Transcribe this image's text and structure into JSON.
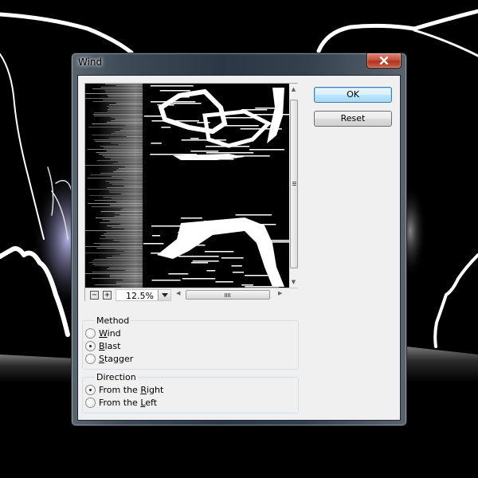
{
  "window": {
    "title": "Wind",
    "close_icon": "close-icon"
  },
  "preview": {
    "zoom_out_label": "−",
    "zoom_in_label": "+",
    "zoom_level": "12.5%",
    "icons": {
      "zoom_out": "minus-icon",
      "zoom_in": "plus-icon",
      "dropdown": "chevron-down-icon",
      "scroll_up": "arrow-up-icon",
      "scroll_down": "arrow-down-icon",
      "scroll_left": "arrow-left-icon",
      "scroll_right": "arrow-right-icon"
    }
  },
  "method": {
    "legend": "Method",
    "options": [
      {
        "pre": "",
        "key": "W",
        "post": "ind",
        "label": "Wind",
        "selected": false
      },
      {
        "pre": "",
        "key": "B",
        "post": "last",
        "label": "Blast",
        "selected": true
      },
      {
        "pre": "",
        "key": "S",
        "post": "tagger",
        "label": "Stagger",
        "selected": false
      }
    ]
  },
  "direction": {
    "legend": "Direction",
    "options": [
      {
        "pre": "From the ",
        "key": "R",
        "post": "ight",
        "label": "From the Right",
        "selected": true
      },
      {
        "pre": "From the ",
        "key": "L",
        "post": "eft",
        "label": "From the Left",
        "selected": false
      }
    ]
  },
  "buttons": {
    "ok": "OK",
    "reset": "Reset"
  }
}
